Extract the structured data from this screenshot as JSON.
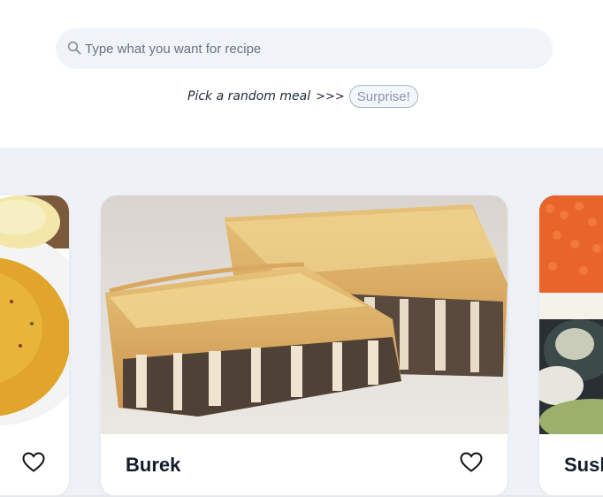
{
  "search": {
    "placeholder": "Type what you want for recipe",
    "icon": "search-icon"
  },
  "random": {
    "label": "Pick a random meal",
    "arrows": ">>>",
    "button_label": "Surprise!"
  },
  "colors": {
    "page_bg": "#ffffff",
    "carousel_bg": "#eef2f7",
    "search_bg": "#f0f3f8",
    "surprise_border": "#a9b4c4",
    "surprise_text": "#8a97aa",
    "title_text": "#141c2b"
  },
  "cards": [
    {
      "title": "",
      "image": "soup-photo",
      "icon": "heart-outline-icon"
    },
    {
      "title": "Burek",
      "image": "burek-photo",
      "icon": "heart-outline-icon"
    },
    {
      "title": "Sush",
      "image": "sushi-photo",
      "icon": "heart-outline-icon"
    }
  ]
}
